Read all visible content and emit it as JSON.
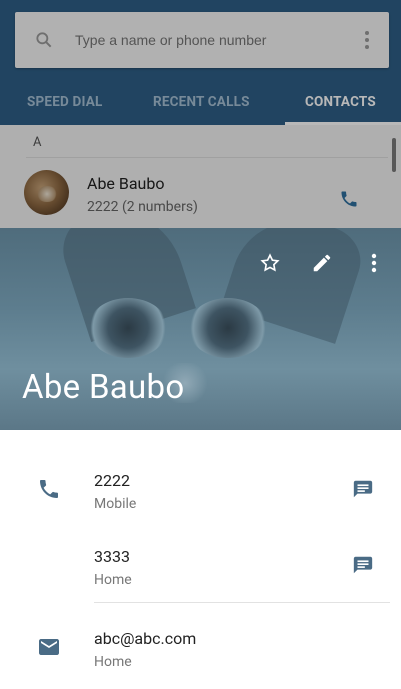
{
  "search": {
    "placeholder": "Type a name or phone number"
  },
  "tabs": [
    {
      "label": "SPEED DIAL"
    },
    {
      "label": "RECENT CALLS"
    },
    {
      "label": "CONTACTS"
    }
  ],
  "contacts_list": {
    "section_letter": "A",
    "item": {
      "name": "Abe Baubo",
      "subtitle": "2222 (2 numbers)"
    }
  },
  "card": {
    "name": "Abe Baubo",
    "actions": [
      "star-icon",
      "edit-icon",
      "more-vert-icon"
    ],
    "entries": [
      {
        "icon": "phone-icon",
        "value": "2222",
        "type": "Mobile",
        "action_icon": "message-icon"
      },
      {
        "value": "3333",
        "type": "Home",
        "action_icon": "message-icon"
      },
      {
        "icon": "email-icon",
        "value": "abc@abc.com",
        "type": "Home"
      }
    ]
  },
  "colors": {
    "primary": "#2e5f87",
    "accent": "#2f6f9f",
    "icon_gray": "#4a6b85"
  }
}
